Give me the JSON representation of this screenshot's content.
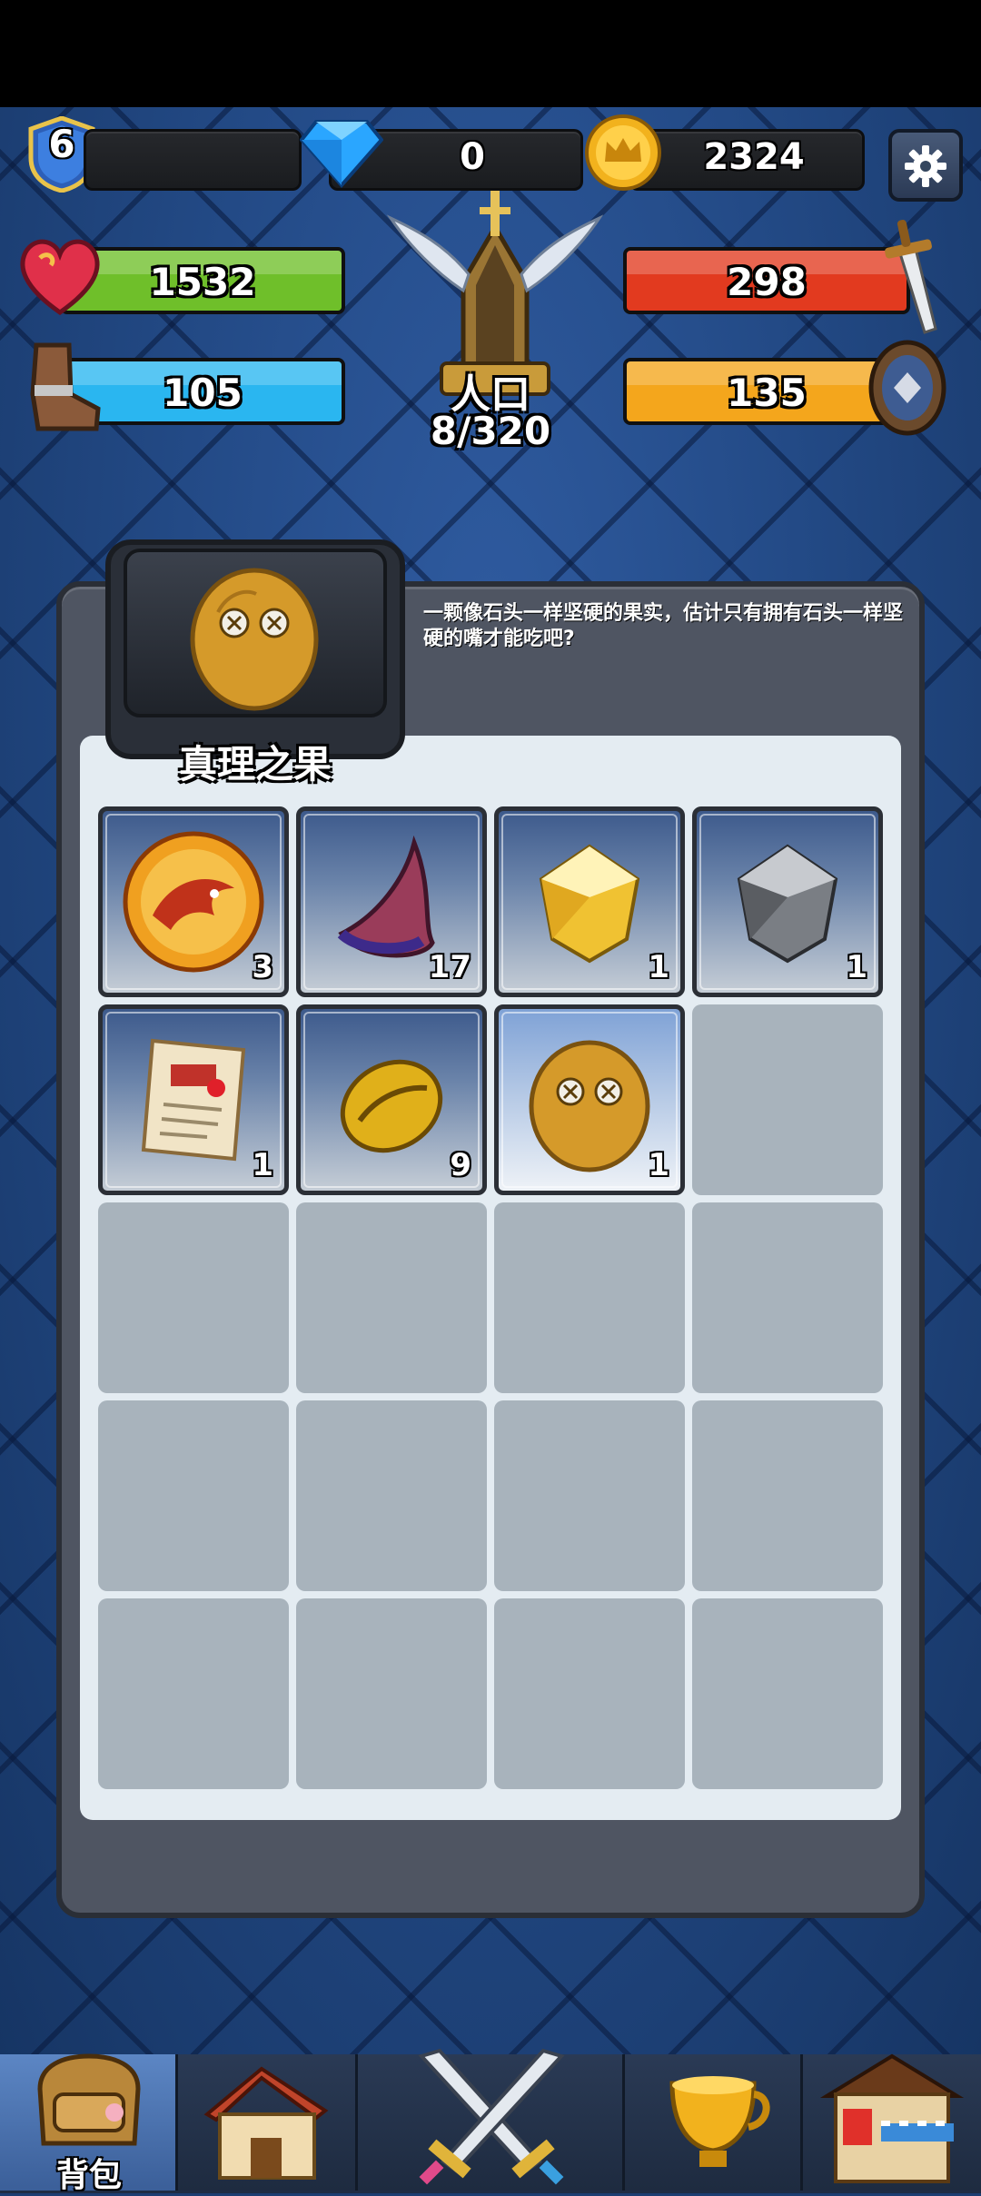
{
  "hud": {
    "level": "6",
    "gems": "0",
    "gold": "2324",
    "colors": {
      "hp": "#6fbf2a",
      "atk": "#e23a1f",
      "def": "#2ab6f0",
      "shield": "#f4a61c"
    }
  },
  "stats": {
    "hp": "1532",
    "attack": "298",
    "speed": "105",
    "defense": "135"
  },
  "population": {
    "label": "人口",
    "count": "8/320"
  },
  "selected_item": {
    "name": "真理之果",
    "description": "一颗像石头一样坚硬的果实，估计只有拥有石头一样坚硬的嘴才能吃吧?",
    "icon": "walnut-icon"
  },
  "inventory": [
    {
      "icon": "dragon-orb-icon",
      "count": "3"
    },
    {
      "icon": "horn-icon",
      "count": "17"
    },
    {
      "icon": "gold-gem-icon",
      "count": "1"
    },
    {
      "icon": "silver-gem-icon",
      "count": "1"
    },
    {
      "icon": "scroll-icon",
      "count": "1"
    },
    {
      "icon": "golden-seed-icon",
      "count": "9"
    },
    {
      "icon": "walnut-icon",
      "count": "1"
    }
  ],
  "nav": {
    "tabs": [
      {
        "icon": "backpack-icon",
        "label": "背包",
        "active": true
      },
      {
        "icon": "house-icon",
        "label": ""
      },
      {
        "icon": "crossed-swords-icon",
        "label": ""
      },
      {
        "icon": "trophy-cup-icon",
        "label": ""
      },
      {
        "icon": "shop-icon",
        "label": ""
      }
    ]
  }
}
